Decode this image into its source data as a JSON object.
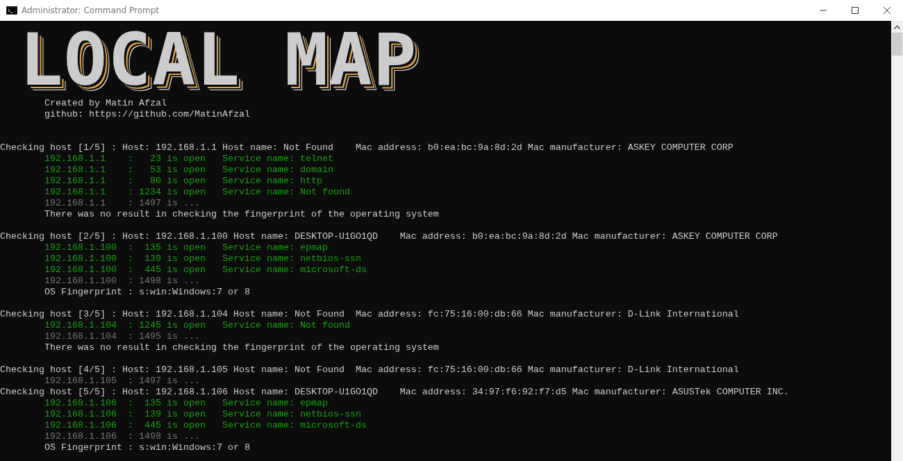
{
  "window": {
    "title": "Administrator: Command Prompt"
  },
  "banner": {
    "logo": "LOCAL MAP",
    "lines": [
      "Created by Matin Afzal",
      "github: https://github.com/MatinAfzal"
    ]
  },
  "console_lines": [
    {
      "kind": "blank"
    },
    {
      "kind": "blank"
    },
    {
      "kind": "header",
      "text": "Checking host [1/5] : Host: 192.168.1.1 Host name: Not Found    Mac address: b0:ea:bc:9a:8d:2d Mac manufacturer: ASKEY COMPUTER CORP"
    },
    {
      "kind": "open",
      "text": "192.168.1.1    :   23 is open   Service name: telnet"
    },
    {
      "kind": "open",
      "text": "192.168.1.1    :   53 is open   Service name: domain"
    },
    {
      "kind": "open",
      "text": "192.168.1.1    :   80 is open   Service name: http"
    },
    {
      "kind": "open",
      "text": "192.168.1.1    : 1234 is open   Service name: Not found"
    },
    {
      "kind": "pending",
      "text": "192.168.1.1    : 1497 is ..."
    },
    {
      "kind": "note",
      "text": "There was no result in checking the fingerprint of the operating system"
    },
    {
      "kind": "blank"
    },
    {
      "kind": "header",
      "text": "Checking host [2/5] : Host: 192.168.1.100 Host name: DESKTOP-U1GO1QD    Mac address: b0:ea:bc:9a:8d:2d Mac manufacturer: ASKEY COMPUTER CORP"
    },
    {
      "kind": "open",
      "text": "192.168.1.100  :  135 is open   Service name: epmap"
    },
    {
      "kind": "open",
      "text": "192.168.1.100  :  139 is open   Service name: netbios-ssn"
    },
    {
      "kind": "open",
      "text": "192.168.1.100  :  445 is open   Service name: microsoft-ds"
    },
    {
      "kind": "pending",
      "text": "192.168.1.100  : 1498 is ..."
    },
    {
      "kind": "note",
      "text": "OS Fingerprint : s:win:Windows:7 or 8"
    },
    {
      "kind": "blank"
    },
    {
      "kind": "header",
      "text": "Checking host [3/5] : Host: 192.168.1.104 Host name: Not Found  Mac address: fc:75:16:00:db:66 Mac manufacturer: D-Link International"
    },
    {
      "kind": "open",
      "text": "192.168.1.104  : 1245 is open   Service name: Not found"
    },
    {
      "kind": "pending",
      "text": "192.168.1.104  : 1495 is ..."
    },
    {
      "kind": "note",
      "text": "There was no result in checking the fingerprint of the operating system"
    },
    {
      "kind": "blank"
    },
    {
      "kind": "header",
      "text": "Checking host [4/5] : Host: 192.168.1.105 Host name: Not Found  Mac address: fc:75:16:00:db:66 Mac manufacturer: D-Link International"
    },
    {
      "kind": "pending",
      "text": "192.168.1.105  : 1497 is ..."
    },
    {
      "kind": "header",
      "text": "Checking host [5/5] : Host: 192.168.1.106 Host name: DESKTOP-U1GO1QD    Mac address: 34:97:f6:92:f7:d5 Mac manufacturer: ASUSTek COMPUTER INC."
    },
    {
      "kind": "open",
      "text": "192.168.1.106  :  135 is open   Service name: epmap"
    },
    {
      "kind": "open",
      "text": "192.168.1.106  :  139 is open   Service name: netbios-ssn"
    },
    {
      "kind": "open",
      "text": "192.168.1.106  :  445 is open   Service name: microsoft-ds"
    },
    {
      "kind": "pending",
      "text": "192.168.1.106  : 1498 is ..."
    },
    {
      "kind": "note",
      "text": "OS Fingerprint : s:win:Windows:7 or 8"
    }
  ]
}
